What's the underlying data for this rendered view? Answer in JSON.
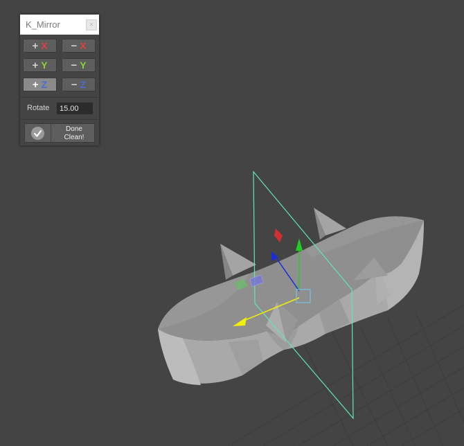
{
  "panel": {
    "title": "K_Mirror",
    "close_glyph": "×",
    "mirror_buttons": [
      {
        "sign": "+",
        "axis": "X",
        "active": false
      },
      {
        "sign": "−",
        "axis": "X",
        "active": false
      },
      {
        "sign": "+",
        "axis": "Y",
        "active": false
      },
      {
        "sign": "−",
        "axis": "Y",
        "active": false
      },
      {
        "sign": "+",
        "axis": "Z",
        "active": true
      },
      {
        "sign": "−",
        "axis": "Z",
        "active": false
      }
    ],
    "rotate_label": "Rotate",
    "rotate_value": "15.00",
    "done_line1": "Done",
    "done_line2": "Clean!",
    "done_icon": "check-icon"
  },
  "viewport": {
    "background": "#444444",
    "grid_color": "#3b3b3b",
    "mesh_color": "#8e8e8e",
    "mirror_plane_color": "#5fe8b0",
    "manipulator_colors": {
      "x": "#d03030",
      "y": "#22cc22",
      "z": "#1a2cd8",
      "free": "#f2f200",
      "center": "#7ac4e0"
    }
  }
}
